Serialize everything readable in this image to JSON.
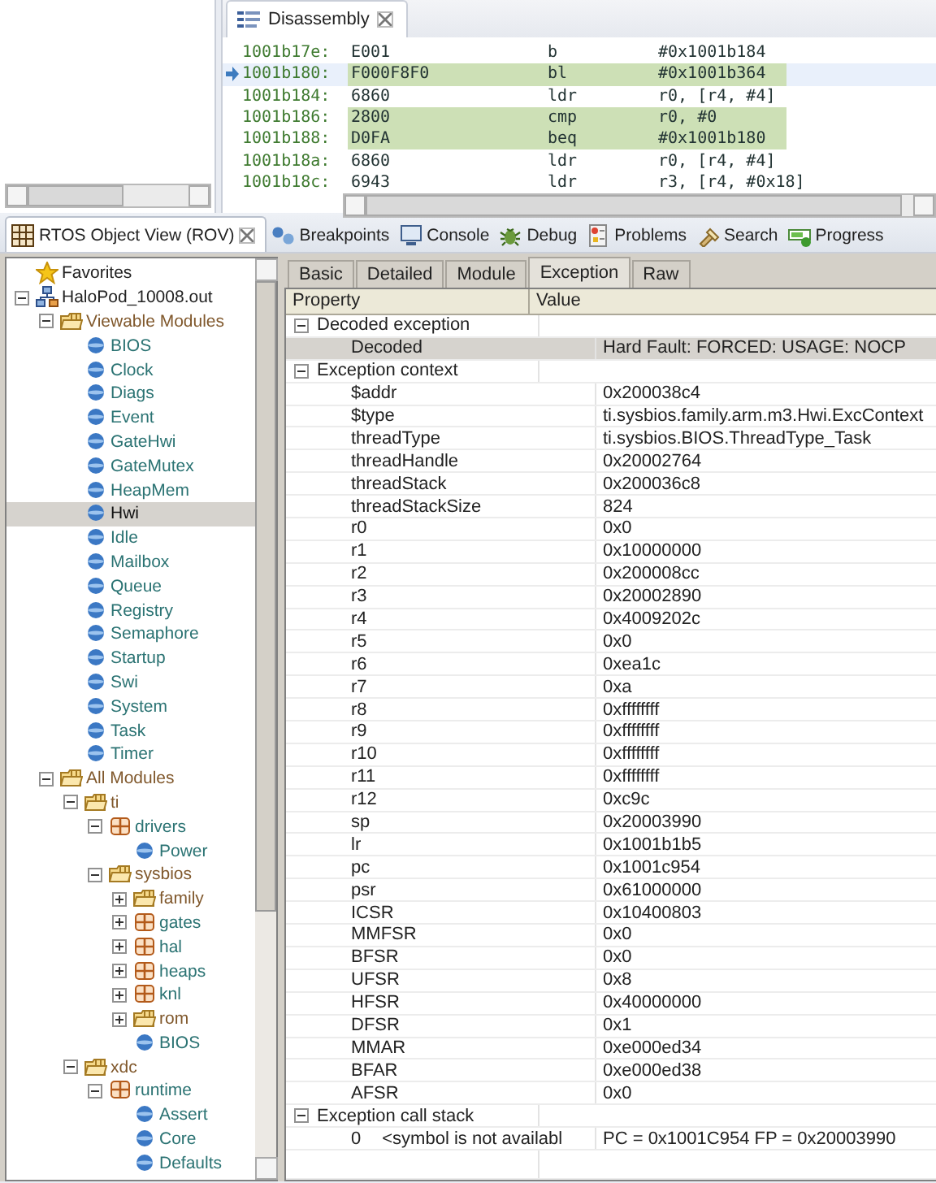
{
  "disassembly": {
    "tab": {
      "title": "Disassembly",
      "selected": true
    },
    "rows": [
      {
        "address": "1001b17e:",
        "opcode": "E001",
        "mnemonic": "b",
        "operand": "#0x1001b184",
        "highlighted": false,
        "current": false
      },
      {
        "address": "1001b180:",
        "opcode": "F000F8F0",
        "mnemonic": "bl",
        "operand": "#0x1001b364",
        "highlighted": true,
        "current": true
      },
      {
        "address": "1001b184:",
        "opcode": "6860",
        "mnemonic": "ldr",
        "operand": "r0, [r4, #4]",
        "highlighted": false,
        "current": false
      },
      {
        "address": "1001b186:",
        "opcode": "2800",
        "mnemonic": "cmp",
        "operand": "r0, #0",
        "highlighted": true,
        "current": false
      },
      {
        "address": "1001b188:",
        "opcode": "D0FA",
        "mnemonic": "beq",
        "operand": "#0x1001b180",
        "highlighted": true,
        "current": false
      },
      {
        "address": "1001b18a:",
        "opcode": "6860",
        "mnemonic": "ldr",
        "operand": "r0, [r4, #4]",
        "highlighted": false,
        "current": false
      },
      {
        "address": "1001b18c:",
        "opcode": "6943",
        "mnemonic": "ldr",
        "operand": "r3, [r4, #0x18]",
        "highlighted": false,
        "current": false
      }
    ]
  },
  "view_tabs": [
    {
      "label": "RTOS Object View (ROV)",
      "kind": "rov",
      "selected": true
    },
    {
      "label": "Breakpoints",
      "kind": "breakpoints",
      "selected": false
    },
    {
      "label": "Console",
      "kind": "console",
      "selected": false
    },
    {
      "label": "Debug",
      "kind": "debug",
      "selected": false
    },
    {
      "label": "Problems",
      "kind": "problems",
      "selected": false
    },
    {
      "label": "Search",
      "kind": "search",
      "selected": false
    },
    {
      "label": "Progress",
      "kind": "progress",
      "selected": false
    }
  ],
  "tree": {
    "items": [
      {
        "label": "Favorites",
        "kind": "favorites",
        "selected": false
      },
      {
        "label": "HaloPod_10008.out",
        "kind": "target",
        "expanded": true,
        "selected": false,
        "children": [
          {
            "label": "Viewable Modules",
            "kind": "folder",
            "expanded": true,
            "selected": false,
            "children": [
              {
                "label": "BIOS",
                "kind": "module",
                "selected": false
              },
              {
                "label": "Clock",
                "kind": "module",
                "selected": false
              },
              {
                "label": "Diags",
                "kind": "module",
                "selected": false
              },
              {
                "label": "Event",
                "kind": "module",
                "selected": false
              },
              {
                "label": "GateHwi",
                "kind": "module",
                "selected": false
              },
              {
                "label": "GateMutex",
                "kind": "module",
                "selected": false
              },
              {
                "label": "HeapMem",
                "kind": "module",
                "selected": false
              },
              {
                "label": "Hwi",
                "kind": "module",
                "selected": true
              },
              {
                "label": "Idle",
                "kind": "module",
                "selected": false
              },
              {
                "label": "Mailbox",
                "kind": "module",
                "selected": false
              },
              {
                "label": "Queue",
                "kind": "module",
                "selected": false
              },
              {
                "label": "Registry",
                "kind": "module",
                "selected": false
              },
              {
                "label": "Semaphore",
                "kind": "module",
                "selected": false
              },
              {
                "label": "Startup",
                "kind": "module",
                "selected": false
              },
              {
                "label": "Swi",
                "kind": "module",
                "selected": false
              },
              {
                "label": "System",
                "kind": "module",
                "selected": false
              },
              {
                "label": "Task",
                "kind": "module",
                "selected": false
              },
              {
                "label": "Timer",
                "kind": "module",
                "selected": false
              }
            ]
          },
          {
            "label": "All Modules",
            "kind": "folder",
            "expanded": true,
            "selected": false,
            "children": [
              {
                "label": "ti",
                "kind": "folder",
                "expanded": true,
                "selected": false,
                "children": [
                  {
                    "label": "drivers",
                    "kind": "package",
                    "expanded": true,
                    "selected": false,
                    "children": [
                      {
                        "label": "Power",
                        "kind": "module",
                        "selected": false
                      }
                    ]
                  },
                  {
                    "label": "sysbios",
                    "kind": "folder",
                    "expanded": true,
                    "selected": false,
                    "children": [
                      {
                        "label": "family",
                        "kind": "folder",
                        "expanded": false,
                        "selected": false
                      },
                      {
                        "label": "gates",
                        "kind": "package",
                        "expanded": false,
                        "selected": false
                      },
                      {
                        "label": "hal",
                        "kind": "package",
                        "expanded": false,
                        "selected": false
                      },
                      {
                        "label": "heaps",
                        "kind": "package",
                        "expanded": false,
                        "selected": false
                      },
                      {
                        "label": "knl",
                        "kind": "package",
                        "expanded": false,
                        "selected": false
                      },
                      {
                        "label": "rom",
                        "kind": "folder",
                        "expanded": false,
                        "selected": false
                      },
                      {
                        "label": "BIOS",
                        "kind": "module",
                        "selected": false
                      }
                    ]
                  }
                ]
              },
              {
                "label": "xdc",
                "kind": "folder",
                "expanded": true,
                "selected": false,
                "children": [
                  {
                    "label": "runtime",
                    "kind": "package",
                    "expanded": true,
                    "selected": false,
                    "children": [
                      {
                        "label": "Assert",
                        "kind": "module",
                        "selected": false
                      },
                      {
                        "label": "Core",
                        "kind": "module",
                        "selected": false
                      },
                      {
                        "label": "Defaults",
                        "kind": "module",
                        "selected": false
                      }
                    ]
                  }
                ]
              }
            ]
          }
        ]
      }
    ]
  },
  "object_tabs": [
    {
      "label": "Basic",
      "selected": false
    },
    {
      "label": "Detailed",
      "selected": false
    },
    {
      "label": "Module",
      "selected": false
    },
    {
      "label": "Exception",
      "selected": true
    },
    {
      "label": "Raw",
      "selected": false
    }
  ],
  "table": {
    "columns": [
      "Property",
      "Value"
    ],
    "groups": [
      {
        "label": "Decoded exception",
        "expanded": true,
        "selected": false,
        "rows": [
          {
            "property": "Decoded",
            "value": "Hard Fault: FORCED: USAGE: NOCP",
            "selected": true
          }
        ]
      },
      {
        "label": "Exception context",
        "expanded": true,
        "selected": false,
        "rows": [
          {
            "property": "$addr",
            "value": "0x200038c4",
            "selected": false
          },
          {
            "property": "$type",
            "value": "ti.sysbios.family.arm.m3.Hwi.ExcContext",
            "selected": false
          },
          {
            "property": "threadType",
            "value": "ti.sysbios.BIOS.ThreadType_Task",
            "selected": false
          },
          {
            "property": "threadHandle",
            "value": "0x20002764",
            "selected": false
          },
          {
            "property": "threadStack",
            "value": "0x200036c8",
            "selected": false
          },
          {
            "property": "threadStackSize",
            "value": "824",
            "selected": false
          },
          {
            "property": "r0",
            "value": "0x0",
            "selected": false
          },
          {
            "property": "r1",
            "value": "0x10000000",
            "selected": false
          },
          {
            "property": "r2",
            "value": "0x200008cc",
            "selected": false
          },
          {
            "property": "r3",
            "value": "0x20002890",
            "selected": false
          },
          {
            "property": "r4",
            "value": "0x4009202c",
            "selected": false
          },
          {
            "property": "r5",
            "value": "0x0",
            "selected": false
          },
          {
            "property": "r6",
            "value": "0xea1c",
            "selected": false
          },
          {
            "property": "r7",
            "value": "0xa",
            "selected": false
          },
          {
            "property": "r8",
            "value": "0xffffffff",
            "selected": false
          },
          {
            "property": "r9",
            "value": "0xffffffff",
            "selected": false
          },
          {
            "property": "r10",
            "value": "0xffffffff",
            "selected": false
          },
          {
            "property": "r11",
            "value": "0xffffffff",
            "selected": false
          },
          {
            "property": "r12",
            "value": "0xc9c",
            "selected": false
          },
          {
            "property": "sp",
            "value": "0x20003990",
            "selected": false
          },
          {
            "property": "lr",
            "value": "0x1001b1b5",
            "selected": false
          },
          {
            "property": "pc",
            "value": "0x1001c954",
            "selected": false
          },
          {
            "property": "psr",
            "value": "0x61000000",
            "selected": false
          },
          {
            "property": "ICSR",
            "value": "0x10400803",
            "selected": false
          },
          {
            "property": "MMFSR",
            "value": "0x0",
            "selected": false
          },
          {
            "property": "BFSR",
            "value": "0x0",
            "selected": false
          },
          {
            "property": "UFSR",
            "value": "0x8",
            "selected": false
          },
          {
            "property": "HFSR",
            "value": "0x40000000",
            "selected": false
          },
          {
            "property": "DFSR",
            "value": "0x1",
            "selected": false
          },
          {
            "property": "MMAR",
            "value": "0xe000ed34",
            "selected": false
          },
          {
            "property": "BFAR",
            "value": "0xe000ed38",
            "selected": false
          },
          {
            "property": "AFSR",
            "value": "0x0",
            "selected": false
          }
        ]
      },
      {
        "label": "Exception call stack",
        "expanded": true,
        "selected": false,
        "rows": [
          {
            "index": "0",
            "property": "<symbol is not availabl",
            "value": "PC = 0x1001C954 FP = 0x20003990",
            "selected": false
          }
        ]
      }
    ]
  }
}
